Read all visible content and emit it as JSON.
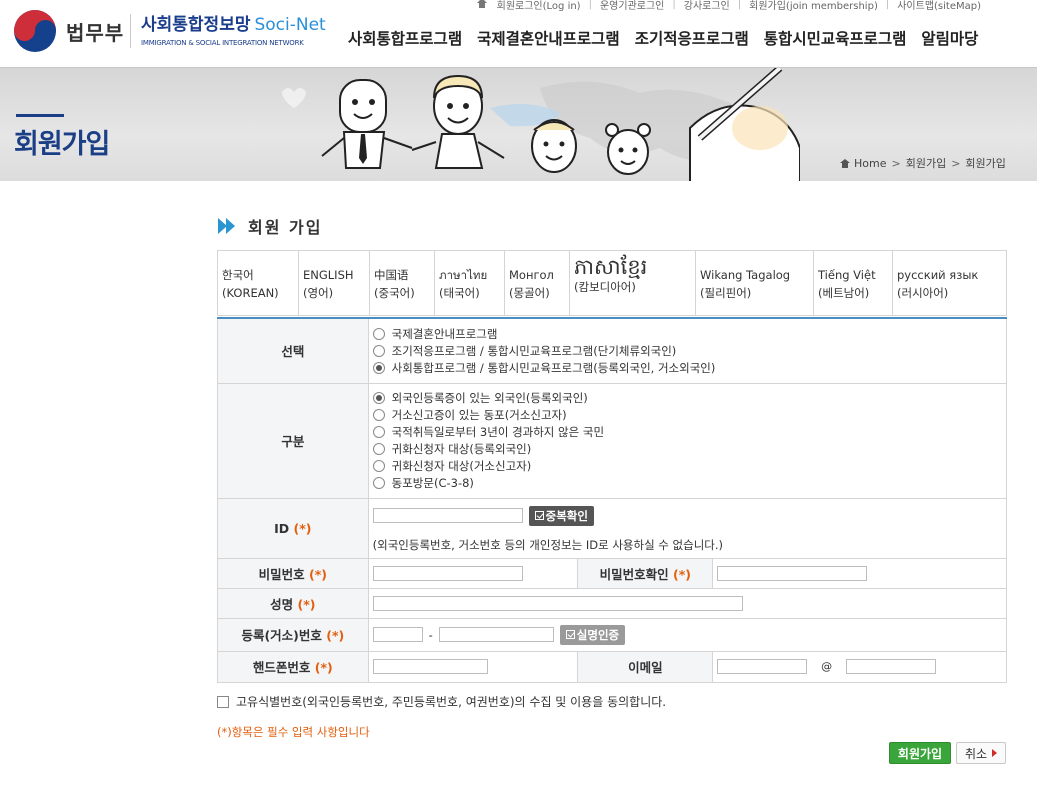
{
  "top_util": {
    "links": [
      "회원로그인(Log in)",
      "운영기관로그인",
      "강사로그인",
      "회원가입(join membership)",
      "사이트맵(siteMap)"
    ]
  },
  "logo": {
    "ministry": "법무부",
    "site_name": "사회통합정보망",
    "site_name_en": "Soci-Net",
    "site_sub": "IMMIGRATION & SOCIAL INTEGRATION NETWORK"
  },
  "gnb": [
    "사회통합프로그램",
    "국제결혼안내프로그램",
    "조기적응프로그램",
    "통합시민교육프로그램",
    "알림마당"
  ],
  "visual": {
    "page_title": "회원가입",
    "breadcrumb": [
      "Home",
      "회원가입",
      "회원가입"
    ]
  },
  "section_title": "회원 가입",
  "languages": [
    {
      "native": "한국어",
      "korean": "(KOREAN)"
    },
    {
      "native": "ENGLISH",
      "korean": "(영어)"
    },
    {
      "native": "中国语",
      "korean": "(중국어)"
    },
    {
      "native": "ภาษาไทย",
      "korean": "(태국어)"
    },
    {
      "native": "Монгол",
      "korean": "(몽골어)"
    },
    {
      "native": "ភាសាខ្មែរ",
      "korean": "(캄보디아어)"
    },
    {
      "native": "Wikang Tagalog",
      "korean": "(필리핀어)"
    },
    {
      "native": "Tiếng Việt",
      "korean": "(베트남어)"
    },
    {
      "native": "русский язык",
      "korean": "(러시아어)"
    }
  ],
  "form": {
    "required_mark": "(*)",
    "select_label": "선택",
    "select_options": [
      {
        "label": "국제결혼안내프로그램",
        "checked": false
      },
      {
        "label": "조기적응프로그램 / 통합시민교육프로그램(단기체류외국인)",
        "checked": false
      },
      {
        "label": "사회통합프로그램 / 통합시민교육프로그램(등록외국인, 거소외국인)",
        "checked": true
      }
    ],
    "type_label": "구분",
    "type_options": [
      {
        "label": "외국인등록증이 있는 외국인(등록외국인)",
        "checked": true
      },
      {
        "label": "거소신고증이 있는 동포(거소신고자)",
        "checked": false
      },
      {
        "label": "국적취득일로부터 3년이 경과하지 않은 국민",
        "checked": false
      },
      {
        "label": "귀화신청자 대상(등록외국인)",
        "checked": false
      },
      {
        "label": "귀화신청자 대상(거소신고자)",
        "checked": false
      },
      {
        "label": "동포방문(C-3-8)",
        "checked": false
      }
    ],
    "id_label": "ID",
    "id_check_button": "중복확인",
    "id_note": "(외국인등록번호, 거소번호 등의 개인정보는 ID로 사용하실 수 없습니다.)",
    "password_label": "비밀번호",
    "password_confirm_label": "비밀번호확인",
    "name_label": "성명",
    "regno_label": "등록(거소)번호",
    "regno_dash": "-",
    "realname_button": "실명인증",
    "phone_label": "핸드폰번호",
    "email_label": "이메일",
    "email_at": "@"
  },
  "agree_text": "고유식별번호(외국인등록번호, 주민등록번호, 여권번호)의 수집 및 이용을 동의합니다.",
  "required_note": "(*)항목은 필수 입력 사항입니다",
  "buttons": {
    "join": "회원가입",
    "cancel": "취소"
  },
  "colors": {
    "brand_navy": "#1b3f86",
    "accent_blue": "#2a95cf",
    "required_orange": "#e35f0d",
    "join_green": "#3aa53a"
  }
}
